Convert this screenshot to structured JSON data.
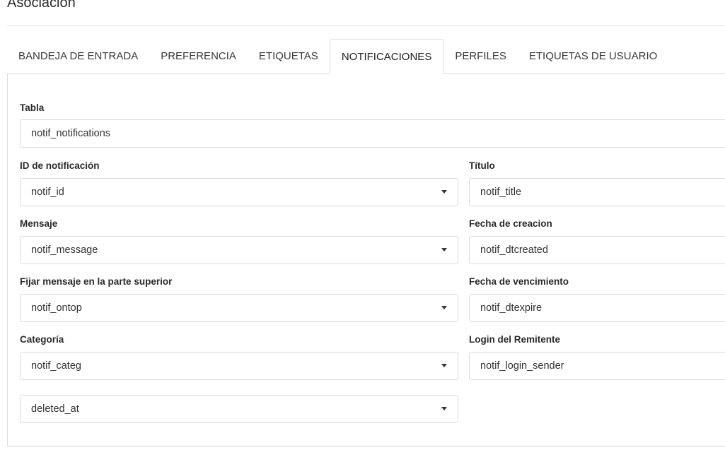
{
  "page": {
    "title": "Asociación"
  },
  "tabs": [
    {
      "label": "BANDEJA DE ENTRADA",
      "active": false
    },
    {
      "label": "PREFERENCIA",
      "active": false
    },
    {
      "label": "ETIQUETAS",
      "active": false
    },
    {
      "label": "NOTIFICACIONES",
      "active": true
    },
    {
      "label": "PERFILES",
      "active": false
    },
    {
      "label": "ETIQUETAS DE USUARIO",
      "active": false
    }
  ],
  "form": {
    "tabla": {
      "label": "Tabla",
      "value": "notif_notifications"
    },
    "id_notificacion": {
      "label": "ID de notificación",
      "value": "notif_id"
    },
    "titulo": {
      "label": "Título",
      "value": "notif_title"
    },
    "mensaje": {
      "label": "Mensaje",
      "value": "notif_message"
    },
    "fecha_creacion": {
      "label": "Fecha de creacion",
      "value": "notif_dtcreated"
    },
    "fijar_mensaje": {
      "label": "Fijar mensaje en la parte superior",
      "value": "notif_ontop"
    },
    "fecha_vencimiento": {
      "label": "Fecha de vencimiento",
      "value": "notif_dtexpire"
    },
    "categoria": {
      "label": "Categoría",
      "value": "notif_categ"
    },
    "login_remitente": {
      "label": "Login del Remitente",
      "value": "notif_login_sender"
    },
    "deleted_at": {
      "value": "deleted_at"
    }
  }
}
